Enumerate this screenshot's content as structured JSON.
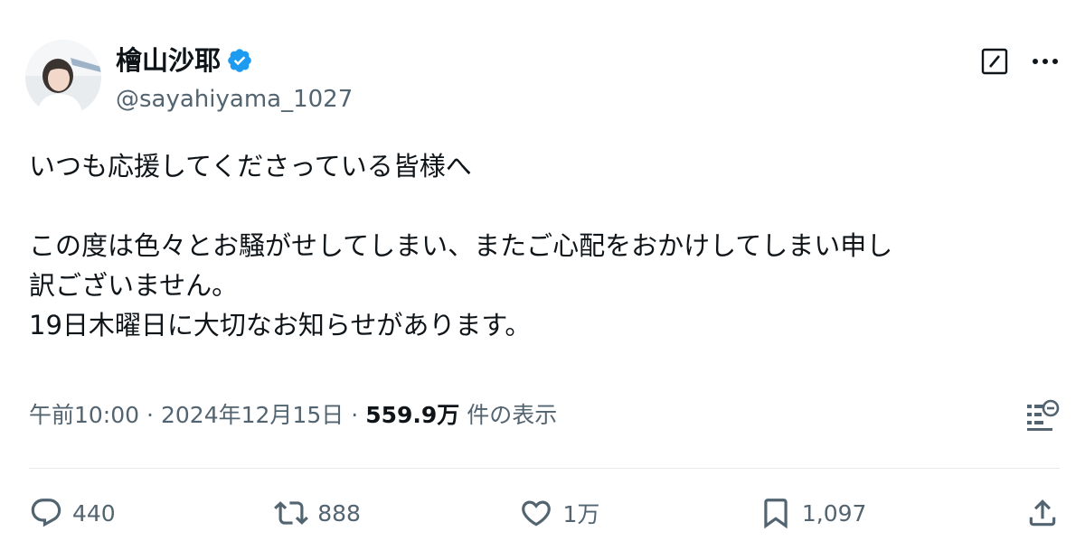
{
  "user": {
    "display_name": "檜山沙耶",
    "handle": "@sayahiyama_1027",
    "verified_icon": "verified-badge-icon",
    "verified_color": "#1d9bf0"
  },
  "tweet": {
    "lines": [
      "いつも応援してくださっている皆様へ",
      "",
      "この度は色々とお騒がせしてしまい、またご心配をおかけしてしまい申し",
      "訳ございません。",
      "19日木曜日に大切なお知らせがあります。"
    ]
  },
  "meta": {
    "time": "午前10:00",
    "separator": "·",
    "date": "2024年12月15日",
    "views_count": "559.9万",
    "views_label": "件の表示"
  },
  "actions": {
    "reply_count": "440",
    "retweet_count": "888",
    "like_count": "1万",
    "bookmark_count": "1,097"
  },
  "colors": {
    "text": "#0f1419",
    "secondary": "#536471",
    "divider": "#e7e9ea"
  }
}
